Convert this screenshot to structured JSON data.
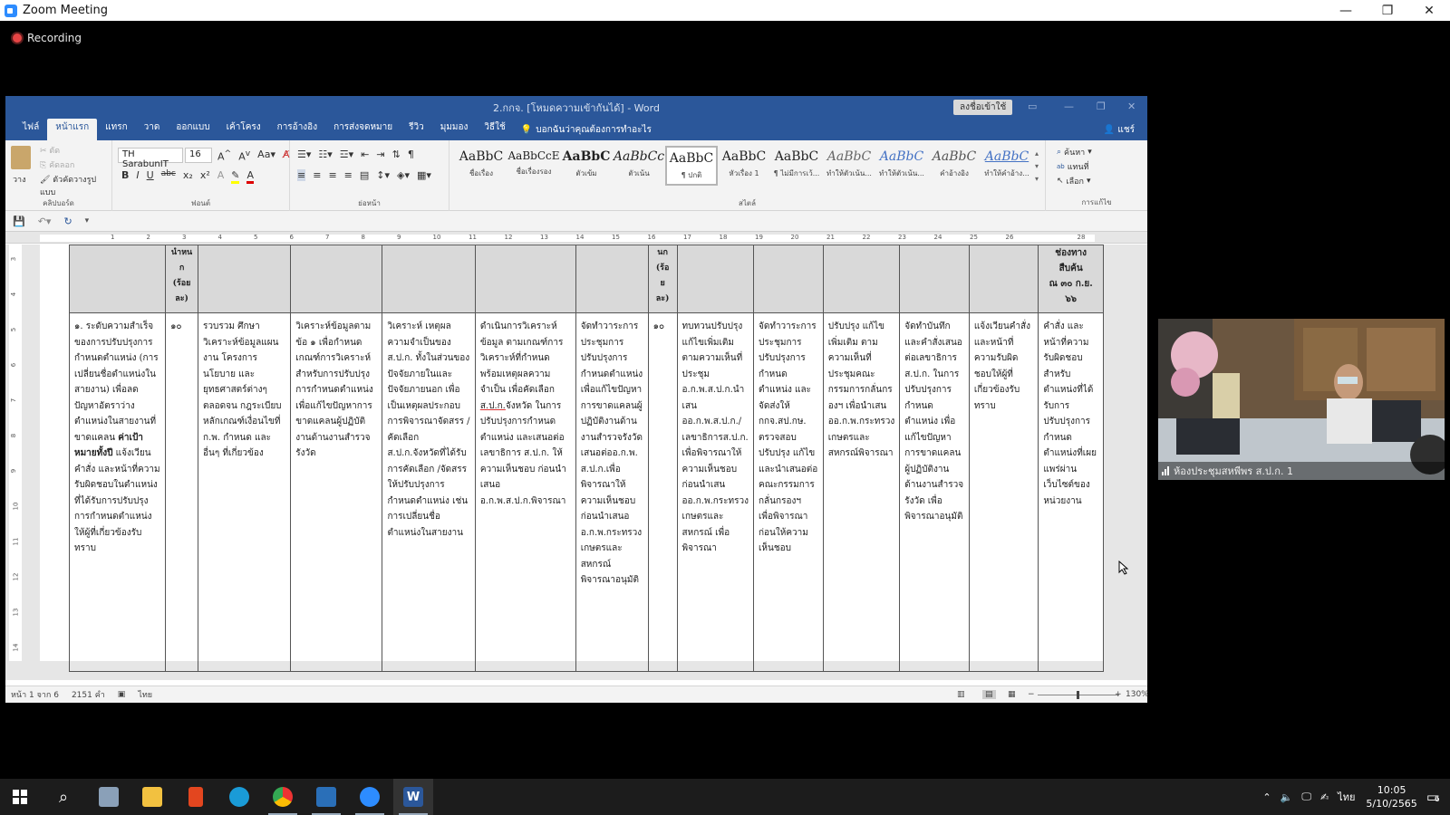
{
  "zoom": {
    "title": "Zoom Meeting",
    "recording_label": "Recording",
    "participant_name": "ห้องประชุมสหพีพร ส.ป.ก. 1"
  },
  "word": {
    "title": "2.กกจ. [โหมดความเข้ากันได้] - Word",
    "signin": "ลงชื่อเข้าใช้",
    "tabs": [
      "ไฟล์",
      "หน้าแรก",
      "แทรก",
      "วาด",
      "ออกแบบ",
      "เค้าโครง",
      "การอ้างอิง",
      "การส่งจดหมาย",
      "รีวิว",
      "มุมมอง",
      "วิธีใช้"
    ],
    "tell_me": "บอกฉันว่าคุณต้องการทำอะไร",
    "share": "แชร์",
    "clipboard": {
      "paste": "วาง",
      "cut": "ตัด",
      "copy": "คัดลอก",
      "format_painter": "ตัวคัดวางรูปแบบ",
      "label": "คลิปบอร์ด"
    },
    "font": {
      "name": "TH SarabunIT",
      "size": "16",
      "label": "ฟอนต์"
    },
    "paragraph_label": "ย่อหน้า",
    "styles_label": "สไตล์",
    "editing_label": "การแก้ไข",
    "styles": [
      {
        "sample": "AaBbC",
        "name": "ชื่อเรื่อง"
      },
      {
        "sample": "AaBbCcE",
        "name": "ชื่อเรื่องรอง"
      },
      {
        "sample": "AaBbC",
        "name": "ตัวเข้ม"
      },
      {
        "sample": "AaBbCc",
        "name": "ตัวเน้น"
      },
      {
        "sample": "AaBbC",
        "name": "¶ ปกติ"
      },
      {
        "sample": "AaBbC",
        "name": "หัวเรื่อง 1"
      },
      {
        "sample": "AaBbC",
        "name": "¶ ไม่มีการเว้..."
      },
      {
        "sample": "AaBbC",
        "name": "ทำให้ตัวเน้น..."
      },
      {
        "sample": "AaBbC",
        "name": "ทำให้ตัวเน้น..."
      },
      {
        "sample": "AaBbC",
        "name": "คำอ้างอิง"
      },
      {
        "sample": "AaBbC",
        "name": "ทำให้คำอ้าง..."
      }
    ],
    "editing": {
      "find": "ค้นหา",
      "replace": "แทนที่",
      "select": "เลือก"
    },
    "status": {
      "page": "หน้า 1 จาก 6",
      "words": "2151 คำ",
      "lang": "ไทย",
      "zoom": "130%"
    },
    "table": {
      "header": [
        "",
        "นำหน\nก\n(ร้อย\nละ)",
        "",
        "",
        "",
        "",
        "",
        "นก\n(ร้อ\nย\nละ)",
        "",
        "",
        "",
        "",
        "",
        "ช่องทาง\nสืบค้น\nณ ๓๐ ก.ย.\n๖๖"
      ],
      "col1": {
        "text1": "๑. ระดับความสำเร็จของการปรับปรุงการกำหนดตำแหน่ง (การเปลี่ยนชื่อตำแหน่งในสายงาน) เพื่อลดปัญหาอัตราว่าง ตำแหน่งในสายงานที่ขาดแคลน",
        "bold": "ค่าเป้าหมายทั้งปี",
        "text2": "แจ้งเวียนคำสั่ง และหน้าที่ความรับผิดชอบในตำแหน่งที่ได้รับการปรับปรุงการกำหนดตำแหน่งให้ผู้ที่เกี่ยวข้องรับทราบ"
      },
      "col2": "๑๐",
      "col3": "รวบรวม ศึกษา วิเคราะห์ข้อมูลแผนงาน โครงการ นโยบาย และยุทธศาสตร์ต่างๆ ตลอดจน กฎระเบียบ หลักเกณฑ์เงื่อนไขที่ ก.พ. กำหนด และอื่นๆ ที่เกี่ยวข้อง",
      "col4": "วิเคราะห์ข้อมูลตามข้อ ๑ เพื่อกำหนดเกณฑ์การวิเคราะห์สำหรับการปรับปรุงการกำหนดตำแหน่งเพื่อแก้ไขปัญหาการขาดแคลนผู้ปฏิบัติงานด้านงานสำรวจรังวัด",
      "col5": "วิเคราะห์ เหตุผลความจำเป็นของส.ป.ก. ทั้งในส่วนของปัจจัยภายในและปัจจัยภายนอก เพื่อเป็นเหตุผลประกอบการพิจารณาจัดสรร / คัดเลือกส.ป.ก.จังหวัดที่ได้รับการคัดเลือก /จัดสรรให้ปรับปรุงการกำหนดตำแหน่ง เช่นการเปลี่ยนชื่อตำแหน่งในสายงาน",
      "col6a": "ดำเนินการวิเคราะห์ข้อมูล ตามเกณฑ์การวิเคราะห์ที่กำหนดพร้อมเหตุผลความจำเป็น เพื่อคัดเลือก",
      "col6u": "ส.ป.ก.",
      "col6b": "จังหวัด ในการปรับปรุงการกำหนดตำแหน่ง และเสนอต่อเลขาธิการ ส.ป.ก. ให้ความเห็นชอบ ก่อนนำเสนอ อ.ก.พ.ส.ป.ก.พิจารณา",
      "col7": "จัดทำวาระการประชุมการปรับปรุงการกำหนดตำแหน่งเพื่อแก้ไขปัญหาการขาดแคลนผู้ปฏิบัติงานด้านงานสำรวจรังวัด เสนอต่ออ.ก.พ. ส.ป.ก.เพื่อพิจารณาให้ความเห็นชอบก่อนนำเสนอ อ.ก.พ.กระทรวงเกษตรและสหกรณ์พิจารณาอนุมัติ",
      "col8": "๑๐",
      "col9": "ทบทวนปรับปรุง แก้ไขเพิ่มเติม ตามความเห็นที่ประชุม อ.ก.พ.ส.ป.ก.นำเสนออ.ก.พ.ส.ป.ก./เลขาธิการส.ป.ก. เพื่อพิจารณาให้ความเห็นชอบก่อนนำเสนออ.ก.พ.กระทรวงเกษตรและสหกรณ์ เพื่อพิจารณา",
      "col10": "จัดทำวาระการประชุมการปรับปรุงการกำหนดตำแหน่ง และจัดส่งให้ กกจ.สป.กษ. ตรวจสอบปรับปรุง แก้ไขและนำเสนอต่อคณะกรรมการกลั่นกรองฯ เพื่อพิจารณาก่อนให้ความเห็นชอบ",
      "col11": "ปรับปรุง แก้ไขเพิ่มเติม ตามความเห็นที่ประชุมคณะกรรมการกลั่นกรองฯ เพื่อนำเสนออ.ก.พ.กระทรวงเกษตรและสหกรณ์พิจารณา",
      "col12": "จัดทำบันทึกและคำสั่งเสนอต่อเลขาธิการส.ป.ก. ในการปรับปรุงการกำหนดตำแหน่ง เพื่อแก้ไขปัญหาการขาดแคลนผู้ปฏิบัติงานด้านงานสำรวจรังวัด เพื่อพิจารณาอนุมัติ",
      "col13": "แจ้งเวียนคำสั่งและหน้าที่ความรับผิดชอบให้ผู้ที่เกี่ยวข้องรับทราบ",
      "col14": "คำสั่ง และหน้าที่ความรับผิดชอบ สำหรับตำแหน่งที่ได้รับการปรับปรุงการกำหนดตำแหน่งที่เผยแพร่ผ่านเว็บไซต์ของหน่วยงาน"
    },
    "ruler_numbers": [
      "1",
      "2",
      "3",
      "4",
      "5",
      "6",
      "7",
      "8",
      "9",
      "10",
      "11",
      "12",
      "13",
      "14",
      "15",
      "16",
      "17",
      "18",
      "19",
      "20",
      "21",
      "22",
      "23",
      "24",
      "25",
      "26",
      "28"
    ],
    "vruler_numbers": [
      "3",
      "4",
      "5",
      "6",
      "7",
      "8",
      "9",
      "10",
      "11",
      "12",
      "13",
      "14"
    ]
  },
  "taskbar": {
    "time": "10:05",
    "date": "5/10/2565",
    "lang": "ไทย",
    "notifications": "6"
  }
}
